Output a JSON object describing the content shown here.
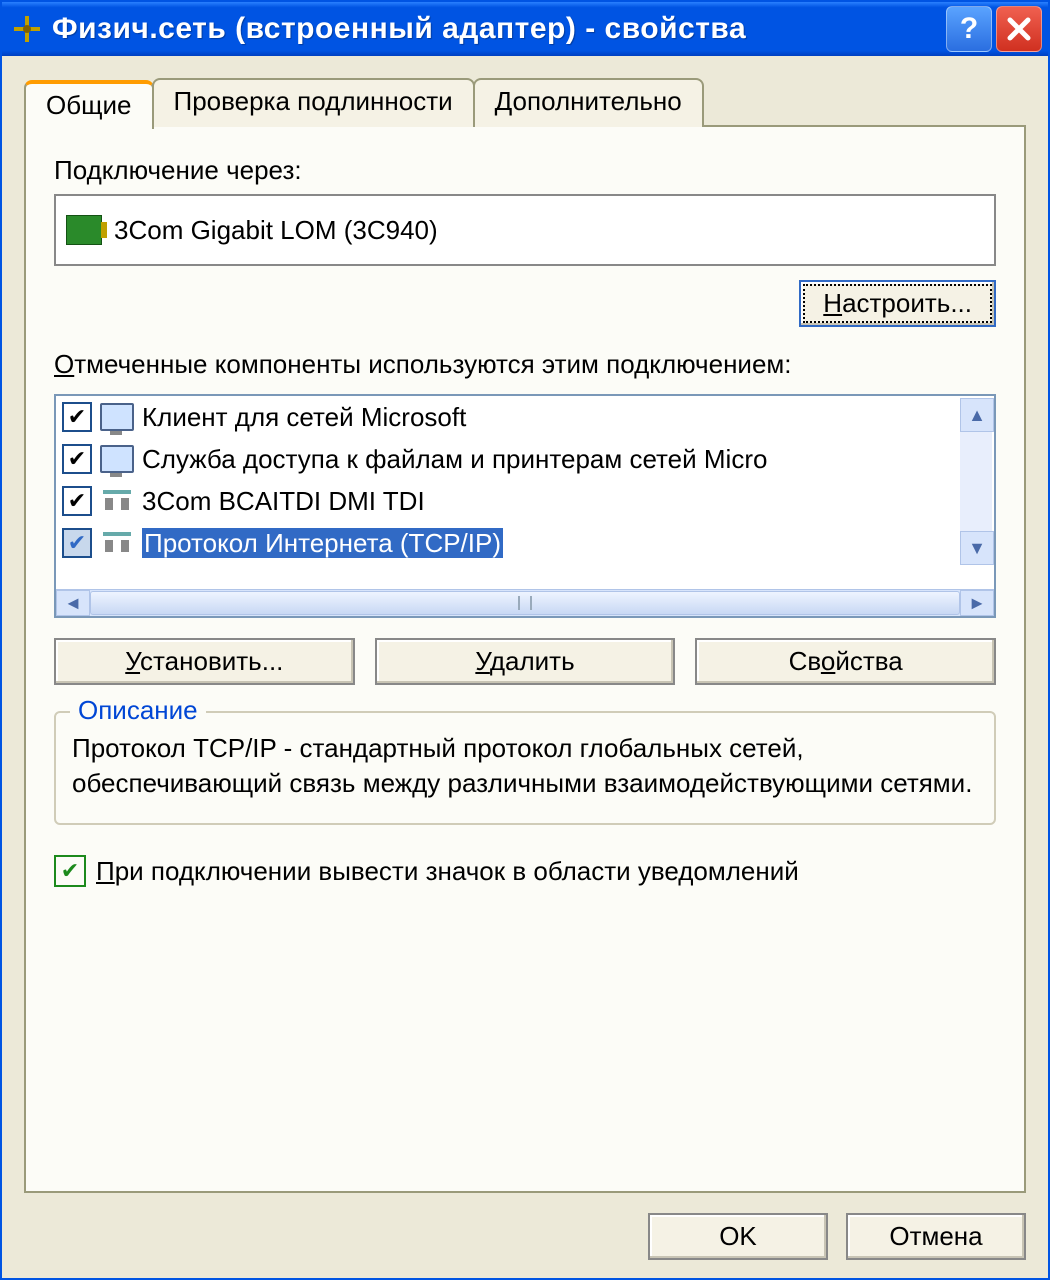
{
  "title": "Физич.сеть (встроенный адаптер) - свойства",
  "tabs": {
    "general": "Общие",
    "auth": "Проверка подлинности",
    "advanced": "Дополнительно"
  },
  "connect_label": "Подключение через:",
  "adapter": "3Com Gigabit LOM (3C940)",
  "configure_btn": "Настроить...",
  "components_label": "Отмеченные компоненты используются этим подключением:",
  "components": [
    {
      "label": "Клиент для сетей Microsoft",
      "checked": true,
      "icon": "monitor",
      "selected": false
    },
    {
      "label": "Служба доступа к файлам и принтерам сетей Micro",
      "checked": true,
      "icon": "monitor",
      "selected": false
    },
    {
      "label": "3Com BCAITDI DMI TDI",
      "checked": true,
      "icon": "proto",
      "selected": false
    },
    {
      "label": "Протокол Интернета (TCP/IP)",
      "checked": true,
      "icon": "proto",
      "selected": true
    }
  ],
  "install_btn": "Установить...",
  "remove_btn": "Удалить",
  "props_btn": "Свойства",
  "group_legend": "Описание",
  "description": "Протокол TCP/IP - стандартный протокол глобальных сетей, обеспечивающий связь между различными взаимодействующими сетями.",
  "notify_label": "При подключении вывести значок в области уведомлений",
  "ok_btn": "OK",
  "cancel_btn": "Отмена"
}
